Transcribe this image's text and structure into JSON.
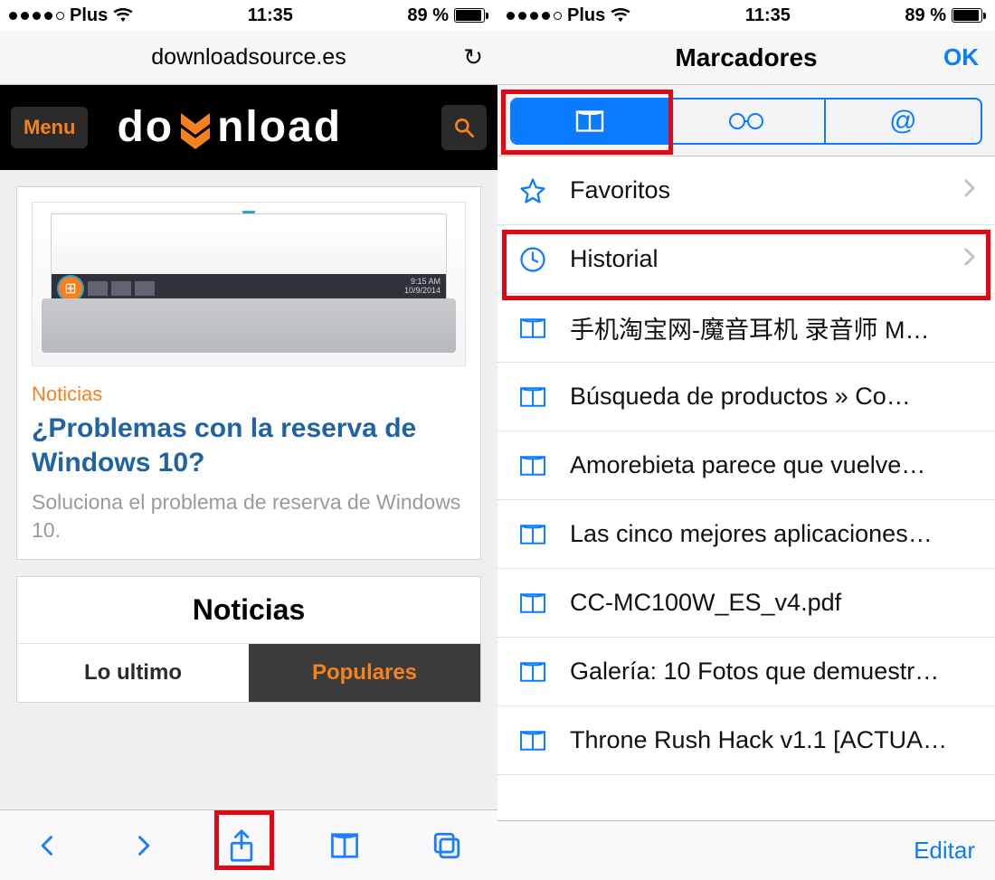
{
  "left": {
    "status": {
      "carrier": "Plus",
      "time": "11:35",
      "battery": "89 %"
    },
    "url": "downloadsource.es",
    "header": {
      "menu": "Menu",
      "logo_part1": "do",
      "logo_part2": "nload"
    },
    "article": {
      "category": "Noticias",
      "title": "¿Problemas con la reserva de Windows 10?",
      "desc": "Soluciona el problema de reserva de Windows 10."
    },
    "news": {
      "header": "Noticias",
      "tab_latest": "Lo ultimo",
      "tab_popular": "Populares"
    }
  },
  "right": {
    "status": {
      "carrier": "Plus",
      "time": "11:35",
      "battery": "89 %"
    },
    "nav": {
      "title": "Marcadores",
      "ok": "OK"
    },
    "rows": [
      {
        "icon": "star",
        "label": "Favoritos",
        "chevron": true
      },
      {
        "icon": "clock",
        "label": "Historial",
        "chevron": true
      },
      {
        "icon": "bookmark",
        "label": "手机淘宝网-魔音耳机 录音师 M…",
        "chevron": false
      },
      {
        "icon": "bookmark",
        "label": "Búsqueda de productos » Co…",
        "chevron": false
      },
      {
        "icon": "bookmark",
        "label": "Amorebieta parece que vuelve…",
        "chevron": false
      },
      {
        "icon": "bookmark",
        "label": "Las cinco mejores aplicaciones…",
        "chevron": false
      },
      {
        "icon": "bookmark",
        "label": "CC-MC100W_ES_v4.pdf",
        "chevron": false
      },
      {
        "icon": "bookmark",
        "label": "Galería: 10 Fotos que demuestr…",
        "chevron": false
      },
      {
        "icon": "bookmark",
        "label": "Throne Rush Hack v1.1 [ACTUA…",
        "chevron": false
      }
    ],
    "edit": "Editar"
  }
}
